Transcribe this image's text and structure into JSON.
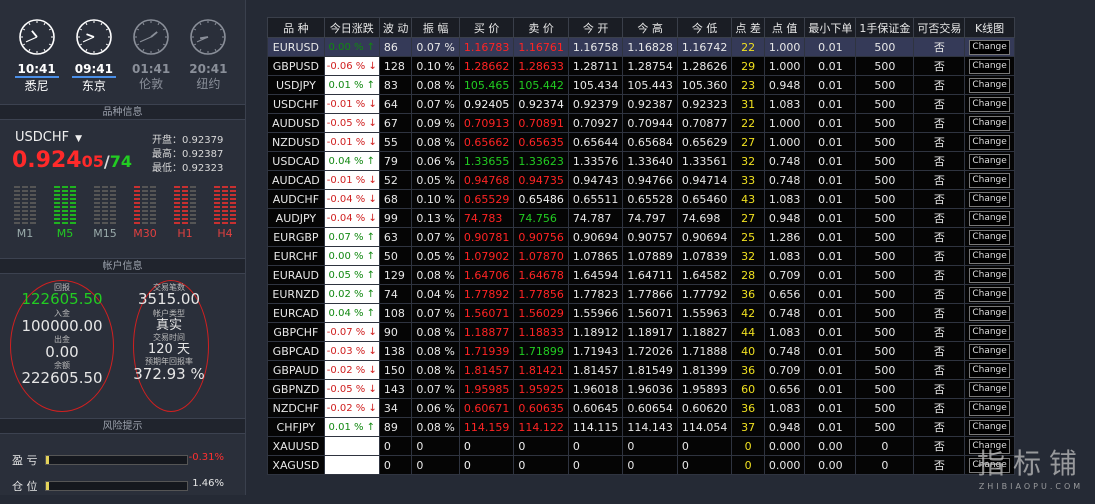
{
  "clocks": [
    {
      "time": "10:41",
      "city": "悉尼",
      "active": true,
      "h": 10,
      "m": 41
    },
    {
      "time": "09:41",
      "city": "东京",
      "active": true,
      "h": 9,
      "m": 41
    },
    {
      "time": "01:41",
      "city": "伦敦",
      "active": false,
      "h": 1,
      "m": 41
    },
    {
      "time": "20:41",
      "city": "纽约",
      "active": false,
      "h": 20,
      "m": 41
    }
  ],
  "symbol_info": {
    "title": "品种信息",
    "symbol": "USDCHF",
    "price_main": "0.924",
    "price_tail": "05",
    "price_ask_tail": "74",
    "open": "开盘：0.92379",
    "high": "最高：0.92387",
    "low": "最低：0.92323",
    "timeframes": [
      {
        "label": "M1",
        "bars": [
          "gray",
          "gray",
          "gray"
        ]
      },
      {
        "label": "M5",
        "bars": [
          "green",
          "green",
          "green"
        ]
      },
      {
        "label": "M15",
        "bars": [
          "gray",
          "gray",
          "gray"
        ]
      },
      {
        "label": "M30",
        "bars": [
          "red",
          "gray",
          "gray"
        ]
      },
      {
        "label": "H1",
        "bars": [
          "red",
          "red",
          "gray"
        ]
      },
      {
        "label": "H4",
        "bars": [
          "red",
          "red",
          "red"
        ]
      }
    ]
  },
  "account": {
    "title": "帐户信息",
    "profit_label": "回报",
    "profit": "122605.50",
    "deposit_label": "入金",
    "deposit": "100000.00",
    "withdraw_label": "出金",
    "withdraw": "0.00",
    "balance_label": "余额",
    "balance": "222605.50",
    "trades_label": "交易笔数",
    "trades": "3515.00",
    "type_label": "帐户类型",
    "type": "真实",
    "time_label": "交易时间",
    "time": "120 天",
    "yield_label": "预期年回报率",
    "yield": "372.93 %"
  },
  "risk": {
    "title": "风险提示",
    "pnl_label": "盈 亏",
    "pnl_value": "-0.31%",
    "pnl_fill": 0.02,
    "pos_label": "仓 位",
    "pos_value": "1.46%",
    "pos_fill": 0.02
  },
  "table": {
    "headers": [
      "品 种",
      "今日涨跌",
      "波 动",
      "振 幅",
      "买 价",
      "卖 价",
      "今 开",
      "今 高",
      "今 低",
      "点 差",
      "点 值",
      "最小下单",
      "1手保证金",
      "可否交易",
      "K线图"
    ],
    "change_btn": "Change",
    "rows": [
      {
        "sym": "EURUSD",
        "chg": "0.00 %",
        "dir": "up",
        "vol": "86",
        "amp": "0.07 %",
        "bid": "1.16783",
        "ask": "1.16761",
        "pc": "red",
        "open": "1.16758",
        "high": "1.16828",
        "low": "1.16742",
        "spread": "22",
        "pv": "1.000",
        "min": "0.01",
        "margin": "500",
        "trade": "否"
      },
      {
        "sym": "GBPUSD",
        "chg": "-0.06 %",
        "dir": "down",
        "vol": "128",
        "amp": "0.10 %",
        "bid": "1.28662",
        "ask": "1.28633",
        "pc": "red",
        "open": "1.28711",
        "high": "1.28754",
        "low": "1.28626",
        "spread": "29",
        "pv": "1.000",
        "min": "0.01",
        "margin": "500",
        "trade": "否"
      },
      {
        "sym": "USDJPY",
        "chg": "0.01 %",
        "dir": "up",
        "vol": "83",
        "amp": "0.08 %",
        "bid": "105.465",
        "ask": "105.442",
        "pc": "grn",
        "open": "105.434",
        "high": "105.443",
        "low": "105.360",
        "spread": "23",
        "pv": "0.948",
        "min": "0.01",
        "margin": "500",
        "trade": "否"
      },
      {
        "sym": "USDCHF",
        "chg": "-0.01 %",
        "dir": "down",
        "vol": "64",
        "amp": "0.07 %",
        "bid": "0.92405",
        "ask": "0.92374",
        "pc": "wht",
        "open": "0.92379",
        "high": "0.92387",
        "low": "0.92323",
        "spread": "31",
        "pv": "1.083",
        "min": "0.01",
        "margin": "500",
        "trade": "否"
      },
      {
        "sym": "AUDUSD",
        "chg": "-0.05 %",
        "dir": "down",
        "vol": "67",
        "amp": "0.09 %",
        "bid": "0.70913",
        "ask": "0.70891",
        "pc": "red",
        "open": "0.70927",
        "high": "0.70944",
        "low": "0.70877",
        "spread": "22",
        "pv": "1.000",
        "min": "0.01",
        "margin": "500",
        "trade": "否"
      },
      {
        "sym": "NZDUSD",
        "chg": "-0.01 %",
        "dir": "down",
        "vol": "55",
        "amp": "0.08 %",
        "bid": "0.65662",
        "ask": "0.65635",
        "pc": "red",
        "open": "0.65644",
        "high": "0.65684",
        "low": "0.65629",
        "spread": "27",
        "pv": "1.000",
        "min": "0.01",
        "margin": "500",
        "trade": "否"
      },
      {
        "sym": "USDCAD",
        "chg": "0.04 %",
        "dir": "up",
        "vol": "79",
        "amp": "0.06 %",
        "bid": "1.33655",
        "ask": "1.33623",
        "pc": "grn",
        "open": "1.33576",
        "high": "1.33640",
        "low": "1.33561",
        "spread": "32",
        "pv": "0.748",
        "min": "0.01",
        "margin": "500",
        "trade": "否"
      },
      {
        "sym": "AUDCAD",
        "chg": "-0.01 %",
        "dir": "down",
        "vol": "52",
        "amp": "0.05 %",
        "bid": "0.94768",
        "ask": "0.94735",
        "pc": "red",
        "open": "0.94743",
        "high": "0.94766",
        "low": "0.94714",
        "spread": "33",
        "pv": "0.748",
        "min": "0.01",
        "margin": "500",
        "trade": "否"
      },
      {
        "sym": "AUDCHF",
        "chg": "-0.04 %",
        "dir": "down",
        "vol": "68",
        "amp": "0.10 %",
        "bid": "0.65529",
        "ask": "0.65486",
        "pc": "mix",
        "open": "0.65511",
        "high": "0.65528",
        "low": "0.65460",
        "spread": "43",
        "pv": "1.083",
        "min": "0.01",
        "margin": "500",
        "trade": "否"
      },
      {
        "sym": "AUDJPY",
        "chg": "-0.04 %",
        "dir": "down",
        "vol": "99",
        "amp": "0.13 %",
        "bid": "74.783",
        "ask": "74.756",
        "pc": "mixg",
        "open": "74.787",
        "high": "74.797",
        "low": "74.698",
        "spread": "27",
        "pv": "0.948",
        "min": "0.01",
        "margin": "500",
        "trade": "否"
      },
      {
        "sym": "EURGBP",
        "chg": "0.07 %",
        "dir": "up",
        "vol": "63",
        "amp": "0.07 %",
        "bid": "0.90781",
        "ask": "0.90756",
        "pc": "red",
        "open": "0.90694",
        "high": "0.90757",
        "low": "0.90694",
        "spread": "25",
        "pv": "1.286",
        "min": "0.01",
        "margin": "500",
        "trade": "否"
      },
      {
        "sym": "EURCHF",
        "chg": "0.00 %",
        "dir": "up",
        "vol": "50",
        "amp": "0.05 %",
        "bid": "1.07902",
        "ask": "1.07870",
        "pc": "red",
        "open": "1.07865",
        "high": "1.07889",
        "low": "1.07839",
        "spread": "32",
        "pv": "1.083",
        "min": "0.01",
        "margin": "500",
        "trade": "否"
      },
      {
        "sym": "EURAUD",
        "chg": "0.05 %",
        "dir": "up",
        "vol": "129",
        "amp": "0.08 %",
        "bid": "1.64706",
        "ask": "1.64678",
        "pc": "red",
        "open": "1.64594",
        "high": "1.64711",
        "low": "1.64582",
        "spread": "28",
        "pv": "0.709",
        "min": "0.01",
        "margin": "500",
        "trade": "否"
      },
      {
        "sym": "EURNZD",
        "chg": "0.02 %",
        "dir": "up",
        "vol": "74",
        "amp": "0.04 %",
        "bid": "1.77892",
        "ask": "1.77856",
        "pc": "red",
        "open": "1.77823",
        "high": "1.77866",
        "low": "1.77792",
        "spread": "36",
        "pv": "0.656",
        "min": "0.01",
        "margin": "500",
        "trade": "否"
      },
      {
        "sym": "EURCAD",
        "chg": "0.04 %",
        "dir": "up",
        "vol": "108",
        "amp": "0.07 %",
        "bid": "1.56071",
        "ask": "1.56029",
        "pc": "red",
        "open": "1.55966",
        "high": "1.56071",
        "low": "1.55963",
        "spread": "42",
        "pv": "0.748",
        "min": "0.01",
        "margin": "500",
        "trade": "否"
      },
      {
        "sym": "GBPCHF",
        "chg": "-0.07 %",
        "dir": "down",
        "vol": "90",
        "amp": "0.08 %",
        "bid": "1.18877",
        "ask": "1.18833",
        "pc": "red",
        "open": "1.18912",
        "high": "1.18917",
        "low": "1.18827",
        "spread": "44",
        "pv": "1.083",
        "min": "0.01",
        "margin": "500",
        "trade": "否"
      },
      {
        "sym": "GBPCAD",
        "chg": "-0.03 %",
        "dir": "down",
        "vol": "138",
        "amp": "0.08 %",
        "bid": "1.71939",
        "ask": "1.71899",
        "pc": "mixg",
        "open": "1.71943",
        "high": "1.72026",
        "low": "1.71888",
        "spread": "40",
        "pv": "0.748",
        "min": "0.01",
        "margin": "500",
        "trade": "否"
      },
      {
        "sym": "GBPAUD",
        "chg": "-0.02 %",
        "dir": "down",
        "vol": "150",
        "amp": "0.08 %",
        "bid": "1.81457",
        "ask": "1.81421",
        "pc": "red",
        "open": "1.81457",
        "high": "1.81549",
        "low": "1.81399",
        "spread": "36",
        "pv": "0.709",
        "min": "0.01",
        "margin": "500",
        "trade": "否"
      },
      {
        "sym": "GBPNZD",
        "chg": "-0.05 %",
        "dir": "down",
        "vol": "143",
        "amp": "0.07 %",
        "bid": "1.95985",
        "ask": "1.95925",
        "pc": "red",
        "open": "1.96018",
        "high": "1.96036",
        "low": "1.95893",
        "spread": "60",
        "pv": "0.656",
        "min": "0.01",
        "margin": "500",
        "trade": "否"
      },
      {
        "sym": "NZDCHF",
        "chg": "-0.02 %",
        "dir": "down",
        "vol": "34",
        "amp": "0.06 %",
        "bid": "0.60671",
        "ask": "0.60635",
        "pc": "red",
        "open": "0.60645",
        "high": "0.60654",
        "low": "0.60620",
        "spread": "36",
        "pv": "1.083",
        "min": "0.01",
        "margin": "500",
        "trade": "否"
      },
      {
        "sym": "CHFJPY",
        "chg": "0.01 %",
        "dir": "up",
        "vol": "89",
        "amp": "0.08 %",
        "bid": "114.159",
        "ask": "114.122",
        "pc": "red",
        "open": "114.115",
        "high": "114.143",
        "low": "114.054",
        "spread": "37",
        "pv": "0.948",
        "min": "0.01",
        "margin": "500",
        "trade": "否"
      },
      {
        "sym": "XAUUSD",
        "chg": "",
        "dir": "",
        "vol": "0",
        "amp": "0",
        "bid": "0",
        "ask": "0",
        "pc": "wht",
        "open": "0",
        "high": "0",
        "low": "0",
        "spread": "0",
        "pv": "0.000",
        "min": "0.00",
        "margin": "0",
        "trade": "否"
      },
      {
        "sym": "XAGUSD",
        "chg": "",
        "dir": "",
        "vol": "0",
        "amp": "0",
        "bid": "0",
        "ask": "0",
        "pc": "wht",
        "open": "0",
        "high": "0",
        "low": "0",
        "spread": "0",
        "pv": "0.000",
        "min": "0.00",
        "margin": "0",
        "trade": "否"
      }
    ]
  },
  "watermark": {
    "big": "指标铺",
    "small": "ZHIBIAOPU.COM"
  }
}
